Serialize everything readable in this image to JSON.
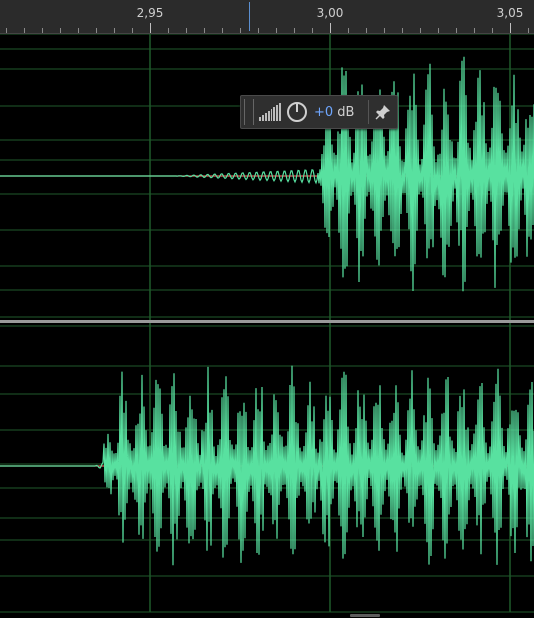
{
  "ruler": {
    "labels": [
      "2,95",
      "3,00",
      "3,05"
    ]
  },
  "hud": {
    "gain_value": "+0",
    "gain_unit": " dB"
  },
  "colors": {
    "waveform": "#58e1a0",
    "center_line": "#e85b5b",
    "grid": "#1f5a2b",
    "ruler_bg": "#2b2b2b",
    "playhead": "#5b8fd0",
    "hud_accent": "#6fa7ff"
  },
  "icons": [
    "grip-icon",
    "volume-icon",
    "gain-knob-icon",
    "pin-icon"
  ]
}
